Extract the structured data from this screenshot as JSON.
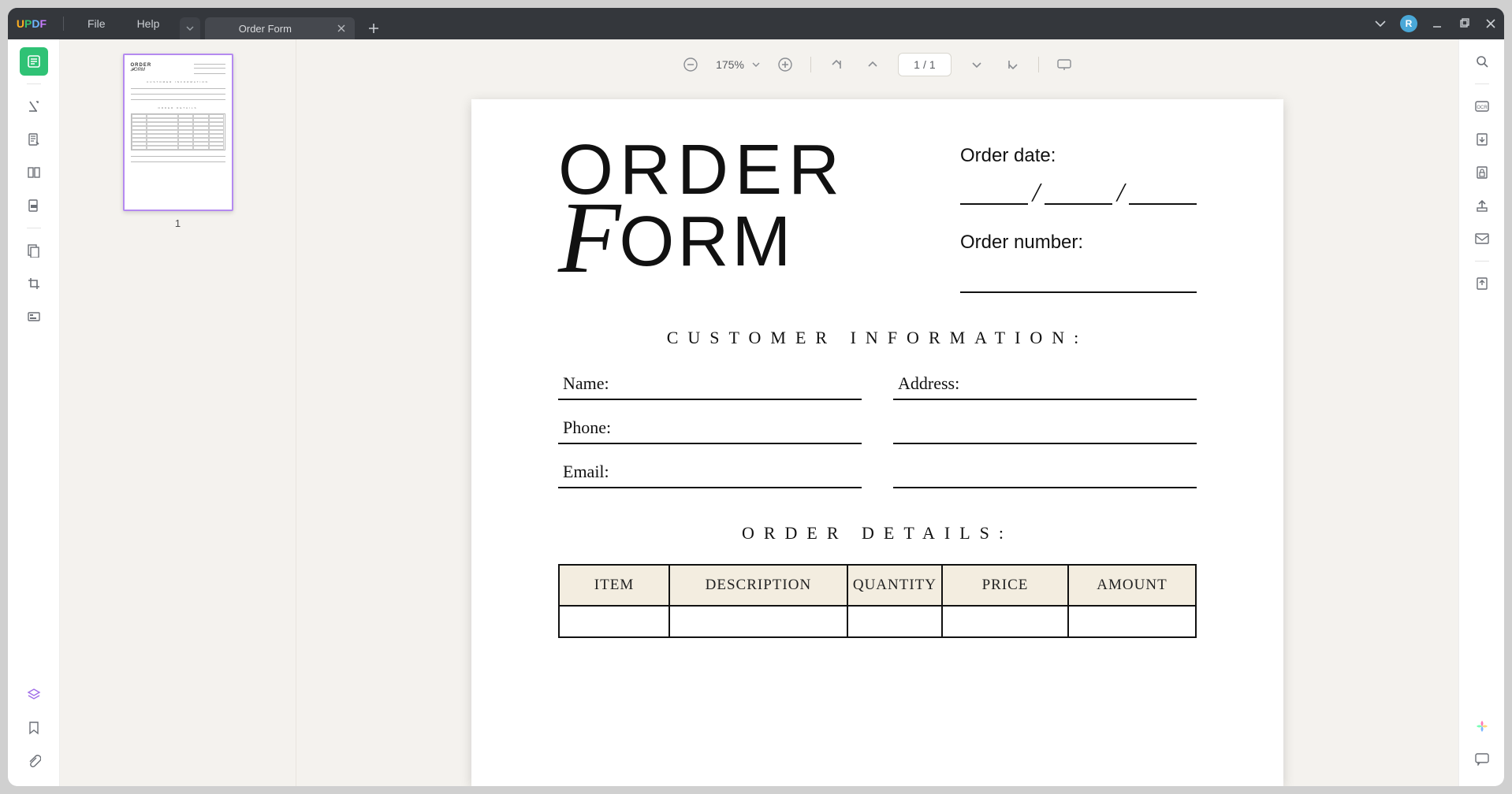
{
  "app": {
    "logo": {
      "u": "U",
      "p": "P",
      "d": "D",
      "f": "F"
    },
    "menus": {
      "file": "File",
      "help": "Help"
    },
    "tab_title": "Order Form",
    "avatar_initial": "R"
  },
  "toolbar": {
    "zoom": "175%",
    "page_current": "1",
    "page_sep": "/",
    "page_total": "1"
  },
  "thumbnail": {
    "page_number": "1"
  },
  "doc": {
    "title_line1": "ORDER",
    "title_line2_script": "F",
    "title_line2_rest": "ORM",
    "order_date_label": "Order date:",
    "order_number_label": "Order number:",
    "customer_info_hdr": "CUSTOMER INFORMATION:",
    "fields": {
      "name": "Name:",
      "phone": "Phone:",
      "email": "Email:",
      "address": "Address:"
    },
    "order_details_hdr": "ORDER DETAILS:",
    "table_headers": {
      "item": "ITEM",
      "description": "DESCRIPTION",
      "quantity": "QUANTITY",
      "price": "PRICE",
      "amount": "AMOUNT"
    }
  }
}
